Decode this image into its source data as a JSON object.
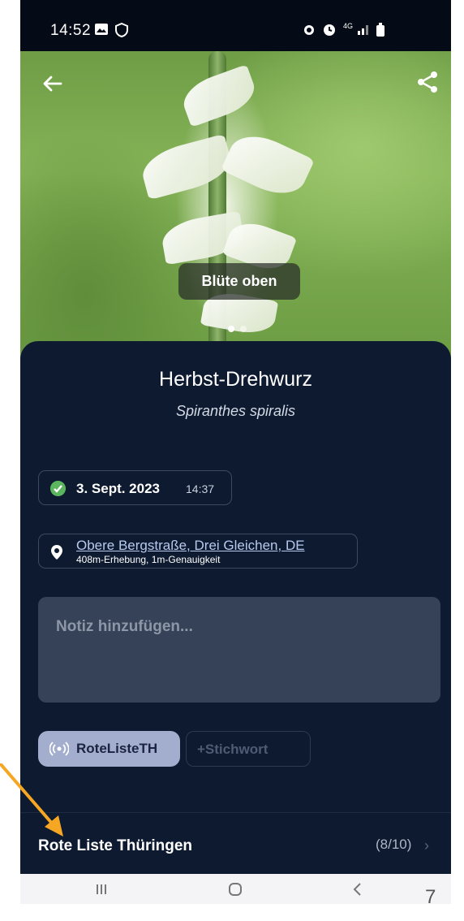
{
  "status_bar": {
    "time": "14:52",
    "network": "4G"
  },
  "photo": {
    "caption": "Blüte oben",
    "pages": 2,
    "current_page": 1
  },
  "species": {
    "common_name": "Herbst-Drehwurz",
    "scientific_name": "Spiranthes spiralis"
  },
  "observation": {
    "date": "3. Sept. 2023",
    "time": "14:37",
    "location": "Obere Bergstraße, Drei Gleichen, DE",
    "location_meta": "408m-Erhebung, 1m-Genauigkeit"
  },
  "note": {
    "placeholder": "Notiz hinzufügen..."
  },
  "tags": {
    "active": "RoteListeTH",
    "add_label": "+Stichwort"
  },
  "red_list": {
    "label": "Rote Liste Thüringen",
    "count": "(8/10)"
  },
  "page_number": "7",
  "colors": {
    "background": "#0d1a30",
    "accent_chip": "#a3aecf",
    "check_green": "#5bb55e",
    "annotation_arrow": "#f5a623"
  },
  "icons": [
    "back-arrow-icon",
    "share-icon",
    "check-circle-icon",
    "location-pin-icon",
    "broadcast-icon",
    "chevron-right-icon",
    "recents-icon",
    "home-icon",
    "back-icon"
  ]
}
